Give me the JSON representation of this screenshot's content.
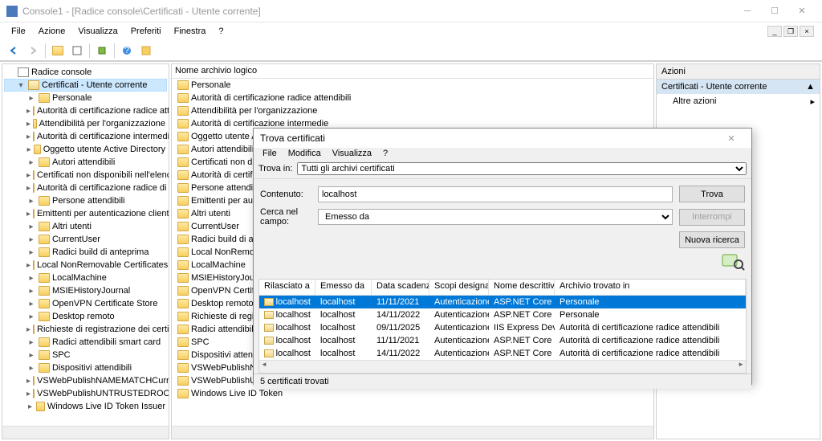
{
  "window": {
    "title": "Console1 - [Radice console\\Certificati - Utente corrente]"
  },
  "menu": {
    "file": "File",
    "azione": "Azione",
    "visualizza": "Visualizza",
    "preferiti": "Preferiti",
    "finestra": "Finestra",
    "help": "?"
  },
  "tree": {
    "root": "Radice console",
    "cert_user": "Certificati - Utente corrente",
    "items": [
      "Personale",
      "Autorità di certificazione radice attendibili",
      "Attendibilità per l'organizzazione",
      "Autorità di certificazione intermedie",
      "Oggetto utente Active Directory",
      "Autori attendibili",
      "Certificati non disponibili nell'elenco locale",
      "Autorità di certificazione radice di terze parti",
      "Persone attendibili",
      "Emittenti per autenticazione client",
      "Altri utenti",
      "CurrentUser",
      "Radici build di anteprima",
      "Local NonRemovable Certificates",
      "LocalMachine",
      "MSIEHistoryJournal",
      "OpenVPN Certificate Store",
      "Desktop remoto",
      "Richieste di registrazione dei certificati",
      "Radici attendibili smart card",
      "SPC",
      "Dispositivi attendibili",
      "VSWebPublishNAMEMATCHCurrentUser",
      "VSWebPublishUNTRUSTEDROOTCurrentUser",
      "Windows Live ID Token Issuer"
    ]
  },
  "center": {
    "header": "Nome archivio logico",
    "items": [
      "Personale",
      "Autorità di certificazione radice attendibili",
      "Attendibilità per l'organizzazione",
      "Autorità di certificazione intermedie",
      "Oggetto utente Active Directory",
      "Autori attendibili",
      "Certificati non disponibili",
      "Autorità di certificazione",
      "Persone attendibili",
      "Emittenti per autenticazione",
      "Altri utenti",
      "CurrentUser",
      "Radici build di anteprima",
      "Local NonRemovable",
      "LocalMachine",
      "MSIEHistoryJournal",
      "OpenVPN Certificate",
      "Desktop remoto",
      "Richieste di registrazione",
      "Radici attendibili smart",
      "SPC",
      "Dispositivi attendibili",
      "VSWebPublishNAME",
      "VSWebPublishUNTRUSTED",
      "Windows Live ID Token"
    ]
  },
  "actions": {
    "header": "Azioni",
    "section": "Certificati - Utente corrente",
    "more": "Altre azioni"
  },
  "dialog": {
    "title": "Trova certificati",
    "menu": {
      "file": "File",
      "modifica": "Modifica",
      "visualizza": "Visualizza",
      "help": "?"
    },
    "searchbar_label": "Trova in:",
    "searchbar_value": "Tutti gli archivi certificati",
    "content_label": "Contenuto:",
    "content_value": "localhost",
    "field_label": "Cerca nel campo:",
    "field_value": "Emesso da",
    "btn_find": "Trova",
    "btn_stop": "Interrompi",
    "btn_new": "Nuova ricerca",
    "cols": {
      "c1": "Rilasciato a",
      "c2": "Emesso da",
      "c3": "Data scadenza",
      "c4": "Scopi designati",
      "c5": "Nome descrittivo",
      "c6": "Archivio trovato in"
    },
    "rows": [
      {
        "c1": "localhost",
        "c2": "localhost",
        "c3": "11/11/2021",
        "c4": "Autenticazione s...",
        "c5": "ASP.NET Core ...",
        "c6": "Personale"
      },
      {
        "c1": "localhost",
        "c2": "localhost",
        "c3": "14/11/2022",
        "c4": "Autenticazione s...",
        "c5": "ASP.NET Core ...",
        "c6": "Personale"
      },
      {
        "c1": "localhost",
        "c2": "localhost",
        "c3": "09/11/2025",
        "c4": "Autenticazione s...",
        "c5": "IIS Express Dev...",
        "c6": "Autorità di certificazione radice attendibili"
      },
      {
        "c1": "localhost",
        "c2": "localhost",
        "c3": "11/11/2021",
        "c4": "Autenticazione s...",
        "c5": "ASP.NET Core ...",
        "c6": "Autorità di certificazione radice attendibili"
      },
      {
        "c1": "localhost",
        "c2": "localhost",
        "c3": "14/11/2022",
        "c4": "Autenticazione s...",
        "c5": "ASP.NET Core ...",
        "c6": "Autorità di certificazione radice attendibili"
      }
    ],
    "status": "5 certificati trovati"
  }
}
